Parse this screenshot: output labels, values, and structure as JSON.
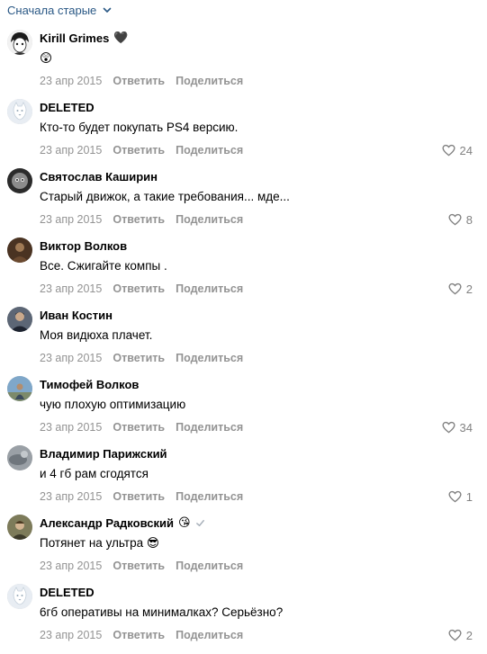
{
  "sort": {
    "label": "Сначала старые"
  },
  "actions": {
    "reply": "Ответить",
    "share": "Поделиться"
  },
  "comments": [
    {
      "author": "Kirill Grimes",
      "name_emoji": "🖤",
      "text": "😲",
      "date": "23 апр 2015",
      "likes": "",
      "avatar": "manga"
    },
    {
      "author": "DELETED",
      "name_emoji": "",
      "text": "Кто-то будет покупать PS4 версию.",
      "date": "23 апр 2015",
      "likes": "24",
      "avatar": "deleted"
    },
    {
      "author": "Святослав Каширин",
      "name_emoji": "",
      "text": "Старый движок, а такие требования... мде...",
      "date": "23 апр 2015",
      "likes": "8",
      "avatar": "dark-grey"
    },
    {
      "author": "Виктор Волков",
      "name_emoji": "",
      "text": "Все. Сжигайте компы .",
      "date": "23 апр 2015",
      "likes": "2",
      "avatar": "brown"
    },
    {
      "author": "Иван Костин",
      "name_emoji": "",
      "text": "Моя видюха плачет.",
      "date": "23 апр 2015",
      "likes": "",
      "avatar": "person-dark"
    },
    {
      "author": "Тимофей Волков",
      "name_emoji": "",
      "text": "чую плохую оптимизацию",
      "date": "23 апр 2015",
      "likes": "34",
      "avatar": "sky"
    },
    {
      "author": "Владимир Парижский",
      "name_emoji": "",
      "text": "и 4 гб рам сгодятся",
      "date": "23 апр 2015",
      "likes": "1",
      "avatar": "grey"
    },
    {
      "author": "Александр Радковский",
      "name_emoji": "😘",
      "verified": true,
      "text": "Потянет на ультра 😎",
      "date": "23 апр 2015",
      "likes": "",
      "avatar": "olive"
    },
    {
      "author": "DELETED",
      "name_emoji": "",
      "text": "6гб оперативы на минималках? Серьёзно?",
      "date": "23 апр 2015",
      "likes": "2",
      "avatar": "deleted"
    }
  ],
  "colors": {
    "link": "#2a5885",
    "meta": "#939393",
    "like": "#828282"
  }
}
